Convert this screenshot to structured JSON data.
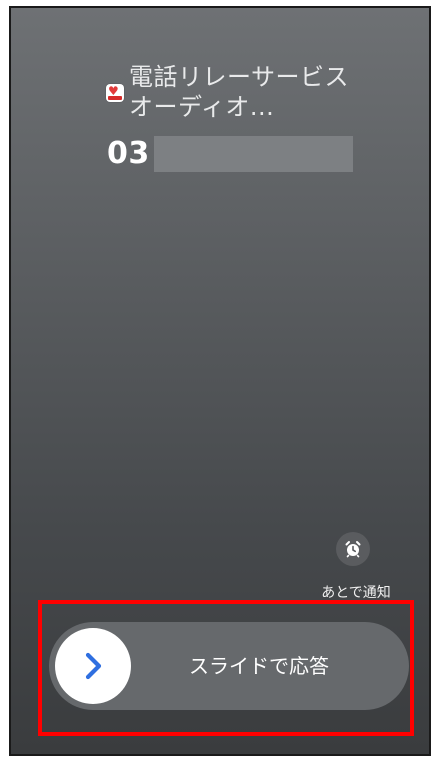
{
  "caller": {
    "name_line1": "電話リレーサービス",
    "name_line2": "オーディオ...",
    "number_visible": "03",
    "app_icon": "telephone-relay-app-icon"
  },
  "actions": {
    "remind_later_label": "あとで通知",
    "remind_icon": "alarm-clock-icon"
  },
  "slider": {
    "label": "スライドで応答",
    "knob_icon": "chevron-right-icon"
  },
  "colors": {
    "highlight": "#ff0000",
    "knob_chevron": "#2f6fe0",
    "background_top": "#6e7174",
    "background_bottom": "#3a3c3e"
  }
}
